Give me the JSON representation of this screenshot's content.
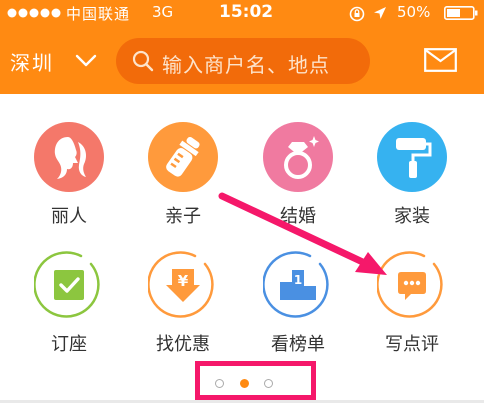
{
  "status_bar": {
    "carrier": "中国联通",
    "network": "3G",
    "time": "15:02",
    "battery": "50%"
  },
  "header": {
    "city": "深圳",
    "search_placeholder": "输入商户名、地点"
  },
  "categories": [
    {
      "label": "丽人",
      "icon": "beauty-woman-icon",
      "color": "#f4786a"
    },
    {
      "label": "亲子",
      "icon": "baby-bottle-icon",
      "color": "#ff9a3c"
    },
    {
      "label": "结婚",
      "icon": "wedding-ring-icon",
      "color": "#f07aa0"
    },
    {
      "label": "家装",
      "icon": "paint-roller-icon",
      "color": "#36b2f0"
    },
    {
      "label": "订座",
      "icon": "reservation-check-icon",
      "color": "#8cc63f"
    },
    {
      "label": "找优惠",
      "icon": "coupon-yen-icon",
      "color": "#ff9a3c"
    },
    {
      "label": "看榜单",
      "icon": "ranking-podium-icon",
      "color": "#4a90e2"
    },
    {
      "label": "写点评",
      "icon": "write-review-icon",
      "color": "#ff9a3c"
    }
  ],
  "pager": {
    "pages": 3,
    "active_index": 1
  },
  "colors": {
    "header_orange": "#ff8a12",
    "annotation_pink": "#f5186a"
  }
}
